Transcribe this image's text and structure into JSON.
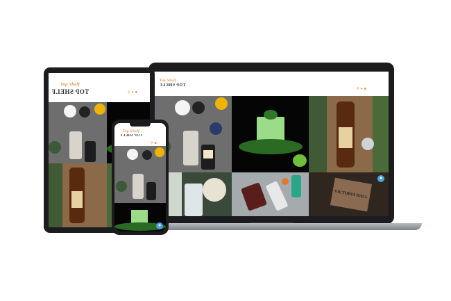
{
  "brand": {
    "name": "TOP SHELF",
    "badge_text": "Top Shelf",
    "accent_color": "#e08a3a"
  },
  "header": {
    "icons": [
      "search-icon",
      "user-icon",
      "cart-icon"
    ]
  },
  "gallery": {
    "tiles": [
      {
        "name": "cocktail-ingredients-flatlay",
        "bg": "#6b6b6b"
      },
      {
        "name": "green-cocktail-glass",
        "bg": "#050505"
      },
      {
        "name": "whiskey-bottle-pinecones",
        "bg": "#8a6a48"
      },
      {
        "name": "gin-bottle-cheese",
        "bg": "#3b4a3a"
      },
      {
        "name": "bottles-garnish-flatlay",
        "bg": "#9aa0a2"
      },
      {
        "name": "victoria-hall-sign",
        "bg": "#3a2f26"
      }
    ],
    "sign_text": "VICTORIA HALL"
  },
  "chat": {
    "icon": "chat-icon"
  }
}
